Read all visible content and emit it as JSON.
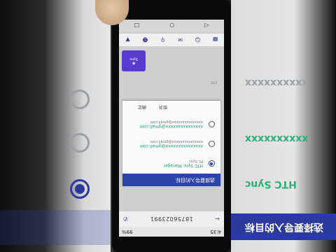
{
  "dialog": {
    "title": "选择要导入的目标",
    "options": [
      {
        "main": "HTC Sync Manager",
        "sub": "PC Sync",
        "selected": true
      },
      {
        "main": "xxxxxxxxxxxxxxx@gmail.com",
        "sub": "xxxxxxxxxxxxxxx@gmail.com",
        "selected": false
      },
      {
        "main": "xxxxxxxxxxxxxxx@gmail.com",
        "sub": "xxxxxxxxxxxxxxx@gmail.com",
        "selected": false
      }
    ],
    "cancel_label": "取消",
    "ok_label": "确定"
  },
  "appbar": {
    "number": "18756023991"
  },
  "statusbar": {
    "time": "4:35",
    "battery": "99%"
  },
  "contact": {
    "name": "HTC",
    "line": "Sync"
  },
  "background": {
    "texts": [
      "HTC Sync",
      "选择要导入的目标",
      "xxxxxxxxxx",
      "xxxxxxxxxx"
    ]
  },
  "icons": [
    "back-arrow-icon",
    "home-icon",
    "recent-apps-icon",
    "phone-icon",
    "message-icon",
    "contacts-icon",
    "grid-icon"
  ]
}
